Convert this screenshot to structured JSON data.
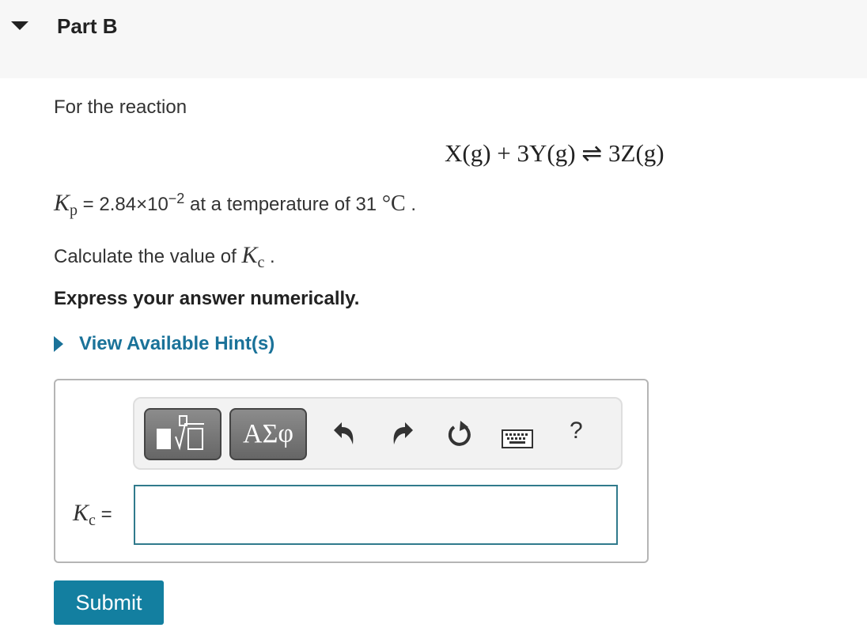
{
  "header": {
    "title": "Part B"
  },
  "problem": {
    "intro": "For the reaction",
    "equation": "X(g) + 3Y(g) ⇌ 3Z(g)",
    "kp_symbol": "K",
    "kp_sub": "p",
    "kp_value_text": " = 2.84×10",
    "kp_exponent": "−2",
    "kp_rest": " at a temperature of 31 ",
    "temp_unit": "°C",
    "period": " .",
    "question_prefix": "Calculate the value of ",
    "kc_symbol": "K",
    "kc_sub": "c",
    "question_suffix": " .",
    "instruction": "Express your answer numerically."
  },
  "hint": {
    "label": "View Available Hint(s)"
  },
  "toolbar": {
    "templates_label": "templates",
    "greek_label": "ΑΣφ",
    "undo": "↶",
    "redo": "↷",
    "reset": "↻",
    "keyboard": "⌨",
    "help": "?"
  },
  "answer": {
    "label_symbol": "K",
    "label_sub": "c",
    "label_eq": " =",
    "value": "",
    "placeholder": ""
  },
  "submit_label": "Submit"
}
